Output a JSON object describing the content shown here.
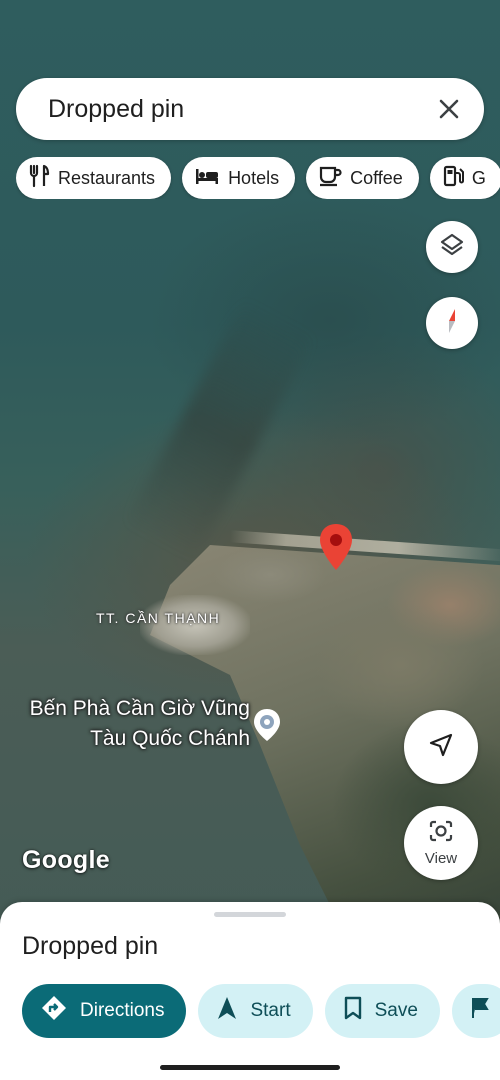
{
  "search": {
    "query": "Dropped pin"
  },
  "chips": [
    {
      "label": "Restaurants",
      "icon": "fork-knife-icon"
    },
    {
      "label": "Hotels",
      "icon": "bed-icon"
    },
    {
      "label": "Coffee",
      "icon": "coffee-cup-icon"
    },
    {
      "label": "G",
      "icon": "gas-pump-icon"
    }
  ],
  "map": {
    "town_label": "TT. CẦN THẠNH",
    "ferry_label_line1": "Bến Phà Cần Giờ Vũng",
    "ferry_label_line2": "Tàu Quốc Chánh",
    "logo": "Google",
    "view_label": "View",
    "colors": {
      "pin": "#ea4335",
      "water": "#2f5d5e"
    }
  },
  "sheet": {
    "title": "Dropped pin",
    "actions": [
      {
        "label": "Directions",
        "icon": "directions-icon",
        "style": "primary"
      },
      {
        "label": "Start",
        "icon": "navigation-arrow-icon",
        "style": "secondary"
      },
      {
        "label": "Save",
        "icon": "bookmark-icon",
        "style": "secondary"
      },
      {
        "label": "",
        "icon": "flag-icon",
        "style": "secondary"
      }
    ],
    "colors": {
      "primary": "#0b6b77",
      "secondary": "#d3f1f5"
    }
  }
}
